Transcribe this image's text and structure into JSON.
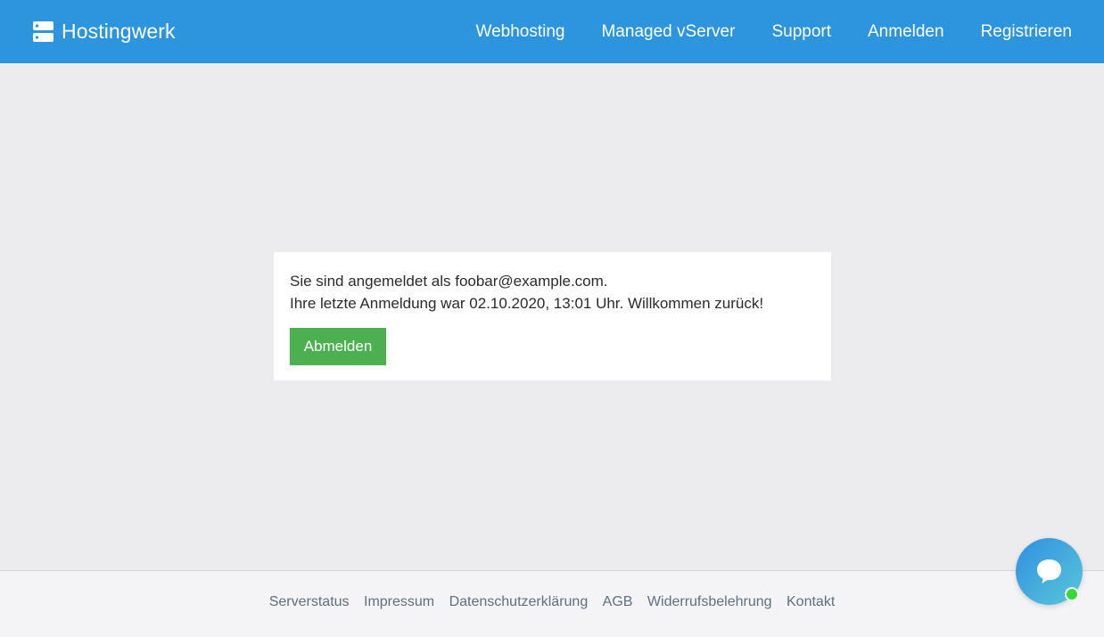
{
  "header": {
    "brand": "Hostingwerk",
    "brand_icon": "server-icon",
    "nav": [
      {
        "label": "Webhosting"
      },
      {
        "label": "Managed vServer"
      },
      {
        "label": "Support"
      },
      {
        "label": "Anmelden"
      },
      {
        "label": "Registrieren"
      }
    ],
    "background_color": "#2d95de"
  },
  "main": {
    "message_line1": "Sie sind angemeldet als foobar@example.com.",
    "message_line2": "Ihre letzte Anmeldung war 02.10.2020, 13:01 Uhr. Willkommen zurück!",
    "logout_label": "Abmelden",
    "button_color": "#4caf50"
  },
  "footer": {
    "links": [
      {
        "label": "Serverstatus"
      },
      {
        "label": "Impressum"
      },
      {
        "label": "Datenschutzerklärung"
      },
      {
        "label": "AGB"
      },
      {
        "label": "Widerrufsbelehrung"
      },
      {
        "label": "Kontakt"
      }
    ]
  },
  "chat_widget": {
    "icon": "chat-bubble-icon",
    "status": "online",
    "status_color": "#39d839"
  }
}
